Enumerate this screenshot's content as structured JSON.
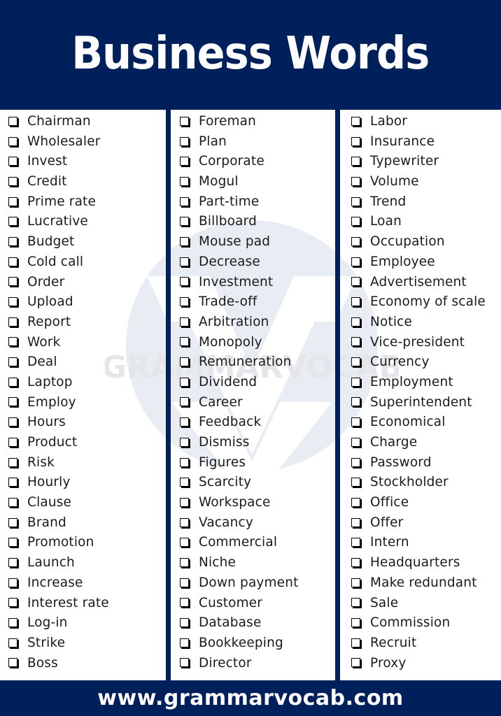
{
  "header": {
    "title": "Business Words"
  },
  "footer": {
    "url": "www.grammarvocab.com"
  },
  "watermark": {
    "text": "GRAMMARVOCAB"
  },
  "colors": {
    "brand_navy": "#00205b",
    "watermark": "#e6eaf2"
  },
  "columns": [
    {
      "words": [
        "Chairman",
        "Wholesaler",
        "Invest",
        "Credit",
        "Prime rate",
        "Lucrative",
        "Budget",
        "Cold call",
        "Order",
        "Upload",
        "Report",
        "Work",
        "Deal",
        "Laptop",
        "Employ",
        "Hours",
        "Product",
        "Risk",
        "Hourly",
        "Clause",
        "Brand",
        "Promotion",
        "Launch",
        "Increase",
        "Interest rate",
        "Log-in",
        "Strike",
        "Boss"
      ]
    },
    {
      "words": [
        "Foreman",
        "Plan",
        "Corporate",
        "Mogul",
        "Part-time",
        "Billboard",
        "Mouse pad",
        "Decrease",
        "Investment",
        "Trade-off",
        "Arbitration",
        "Monopoly",
        "Remuneration",
        "Dividend",
        "Career",
        "Feedback",
        "Dismiss",
        "Figures",
        "Scarcity",
        "Workspace",
        "Vacancy",
        "Commercial",
        "Niche",
        "Down payment",
        "Customer",
        "Database",
        "Bookkeeping",
        "Director"
      ]
    },
    {
      "words": [
        "Labor",
        "Insurance",
        "Typewriter",
        "Volume",
        "Trend",
        "Loan",
        "Occupation",
        "Employee",
        "Advertisement",
        "Economy of scale",
        "Notice",
        "Vice-president",
        "Currency",
        "Employment",
        "Superintendent",
        "Economical",
        "Charge",
        "Password",
        "Stockholder",
        "Office",
        "Offer",
        "Intern",
        "Headquarters",
        "Make redundant",
        "Sale",
        "Commission",
        "Recruit",
        "Proxy"
      ]
    }
  ]
}
